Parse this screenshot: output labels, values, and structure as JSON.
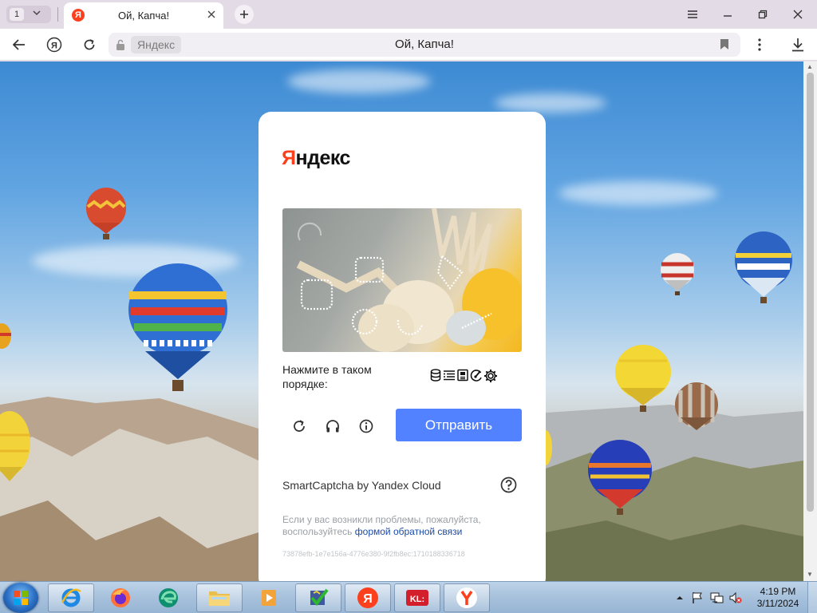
{
  "browser": {
    "tab_count": "1",
    "active_tab": {
      "title": "Ой, Капча!",
      "favicon_letter": "Я"
    },
    "omnibox": {
      "chip_label": "Яндекс",
      "page_title": "Ой, Капча!"
    }
  },
  "captcha": {
    "logo_first": "Я",
    "logo_rest": "ндекс",
    "instruction": "Нажмите в таком порядке:",
    "order_icons": [
      "database-icon",
      "list-icon",
      "document-icon",
      "gauge-icon",
      "gear-icon"
    ],
    "submit_label": "Отправить",
    "brand_line": "SmartCaptcha by Yandex Cloud",
    "feedback_text": "Если у вас возникли проблемы, пожалуйста, воспользуйтесь ",
    "feedback_link": "формой обратной связи",
    "request_id": "73878efb-1e7e156a-4776e380-9f2fb8ec:1710188336718"
  },
  "taskbar": {
    "apps": [
      "internet-explorer",
      "firefox",
      "edge",
      "file-explorer",
      "media-player",
      "checker-app",
      "yandex",
      "kl-app",
      "yandex-browser"
    ],
    "clock": {
      "time": "4:19 PM",
      "date": "3/11/2024"
    }
  },
  "colors": {
    "yandex_red": "#fc3f1d",
    "submit_blue": "#5282ff",
    "link_blue": "#1b4aa6"
  }
}
